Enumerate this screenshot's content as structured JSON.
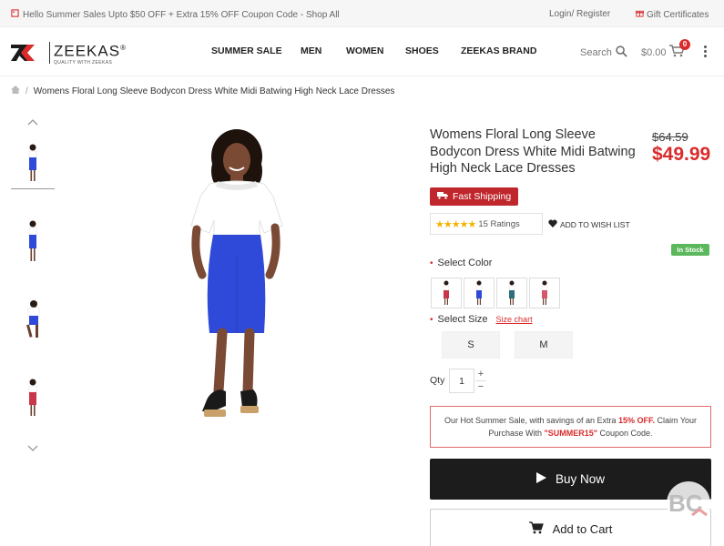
{
  "topbar": {
    "promo": "Hello Summer Sales Upto $50 OFF + Extra 15% OFF Coupon Code - Shop All",
    "login": "Login/ Register",
    "gift": "Gift Certificates"
  },
  "header": {
    "brand": "ZEEKAS",
    "registered": "®",
    "tagline": "QUALITY WITH ZEEKAS",
    "nav": [
      "SUMMER SALE",
      "MEN",
      "WOMEN",
      "SHOES",
      "ZEEKAS BRAND"
    ],
    "search": "Search",
    "cart_total": "$0.00",
    "cart_count": "0"
  },
  "breadcrumb": {
    "current": "Womens Floral Long Sleeve Bodycon Dress White Midi Batwing High Neck Lace Dresses"
  },
  "product": {
    "title": "Womens Floral Long Sleeve Bodycon Dress White Midi Batwing High Neck Lace Dresses",
    "old_price": "$64.59",
    "price": "$49.99",
    "fast_shipping": "Fast Shipping",
    "stars": "★★★★★",
    "rating": 5,
    "ratings_text": "15 Ratings",
    "wishlist": "ADD TO WISH LIST",
    "stock": "In Stock",
    "select_color": "Select Color",
    "select_size": "Select Size",
    "size_chart": "Size chart",
    "sizes": [
      "S",
      "M"
    ],
    "qty_label": "Qty",
    "qty": "1",
    "plus": "+",
    "minus": "−",
    "promo_a": "Our Hot Summer Sale, with savings of an Extra ",
    "promo_b": "15% OFF.",
    "promo_c": " Claim Your Purchase With ",
    "promo_d": "\"SUMMER15\"",
    "promo_e": " Coupon Code.",
    "buy_now": "Buy Now",
    "add_to_cart": "Add to Cart"
  },
  "colors": {
    "accent": "#d92b2b",
    "dress_blue": "#2f4ad8",
    "dress_pink": "#d6576a",
    "dress_teal": "#2b6f7a",
    "stock_green": "#5cb85c"
  }
}
